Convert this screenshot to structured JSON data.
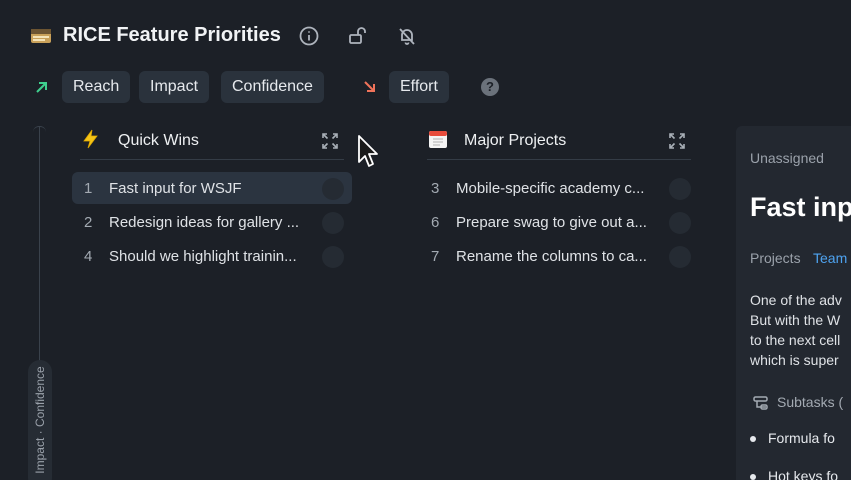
{
  "header": {
    "title": "RICE Feature Priorities",
    "icons": [
      "board-emoji-icon",
      "info-icon",
      "unlock-icon",
      "notifications-off-icon"
    ]
  },
  "filters": {
    "up_icon": "arrow-up-right-icon",
    "up_chips": [
      "Reach",
      "Impact",
      "Confidence"
    ],
    "down_icon": "arrow-down-right-icon",
    "down_chips": [
      "Effort"
    ],
    "help_label": "?"
  },
  "y_axis": {
    "label": "Impact · Confidence"
  },
  "columns": [
    {
      "title": "Quick Wins",
      "icon": "lightning-icon",
      "items": [
        {
          "num": "1",
          "text": "Fast input for WSJF",
          "selected": true
        },
        {
          "num": "2",
          "text": "Redesign ideas for gallery ...",
          "selected": false
        },
        {
          "num": "4",
          "text": "Should we highlight trainin...",
          "selected": false
        }
      ]
    },
    {
      "title": "Major Projects",
      "icon": "calendar-icon",
      "items": [
        {
          "num": "3",
          "text": "Mobile-specific academy c...",
          "selected": false
        },
        {
          "num": "6",
          "text": "Prepare swag to give out a...",
          "selected": false
        },
        {
          "num": "7",
          "text": "Rename the columns to ca...",
          "selected": false
        }
      ]
    }
  ],
  "detail": {
    "assignee": "Unassigned",
    "title": "Fast inp",
    "projects_label": "Projects",
    "project_value": "Team",
    "description": [
      "One of the adv",
      "But with the W",
      "to the next cell",
      "which is super"
    ],
    "subtasks_label": "Subtasks (",
    "subtasks": [
      "Formula fo",
      "Hot keys fo"
    ]
  },
  "colors": {
    "background": "#1c2027",
    "chip": "#2a323c",
    "selected_row": "#2b3440",
    "accent_up": "#3ecf8e",
    "accent_down": "#f0735a",
    "link": "#4ea3f0"
  }
}
